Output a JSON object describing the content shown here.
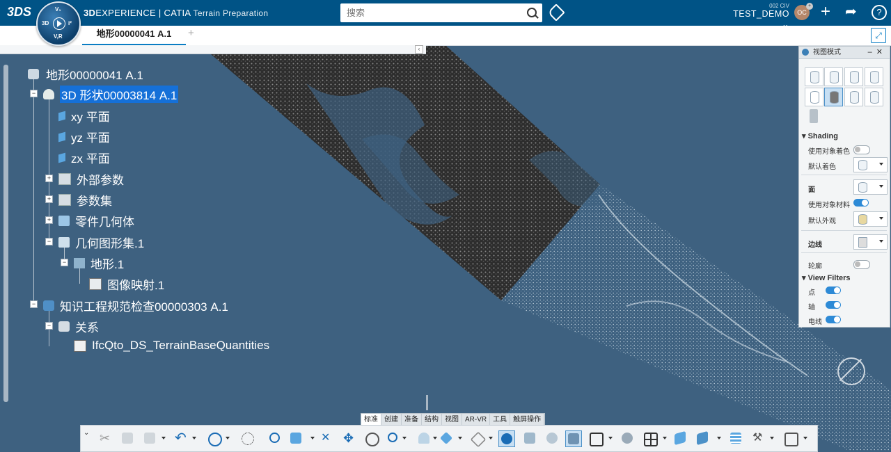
{
  "app": {
    "brand_bold": "3D",
    "brand_mid": "EXPERIENCE | CATIA",
    "app_name": "Terrain Preparation",
    "compass_labels": {
      "top": "V₁",
      "left": "3D",
      "right": "i²",
      "bottom": "V,R"
    }
  },
  "search": {
    "placeholder": "搜索"
  },
  "user": {
    "tenant": "002 CIV",
    "name": "TEST_DEMO",
    "initials": "OC"
  },
  "tabs": [
    {
      "label": "地形00000041 A.1"
    }
  ],
  "tab_add": "+",
  "tree": {
    "nodes": [
      {
        "label": "地形00000041 A.1"
      },
      {
        "label": "3D 形状00003814 A.1"
      },
      {
        "label": "xy 平面"
      },
      {
        "label": "yz 平面"
      },
      {
        "label": "zx 平面"
      },
      {
        "label": "外部参数"
      },
      {
        "label": "参数集"
      },
      {
        "label": "零件几何体"
      },
      {
        "label": "几何图形集.1"
      },
      {
        "label": "地形.1"
      },
      {
        "label": "图像映射.1"
      },
      {
        "label": "知识工程规范检查00000303 A.1"
      },
      {
        "label": "关系"
      },
      {
        "label": "IfcQto_DS_TerrainBaseQuantities"
      }
    ]
  },
  "panel": {
    "title": "视图模式",
    "shading_title": "Shading",
    "use_object_color": "使用对象着色",
    "default_color": "默认着色",
    "face": "面",
    "use_object_material": "使用对象材料",
    "default_appearance": "默认外观",
    "edge": "边线",
    "outline": "轮廓",
    "view_filters_title": "View Filters",
    "points": "点",
    "axis": "轴",
    "wires": "电线"
  },
  "bottom_tabs": [
    "标准",
    "创建",
    "准备",
    "结构",
    "视图",
    "AR-VR",
    "工具",
    "触屏操作"
  ],
  "colors": {
    "header": "#005386",
    "background": "#3e6180",
    "accent": "#0a7dc4",
    "selection": "#1570d8"
  }
}
